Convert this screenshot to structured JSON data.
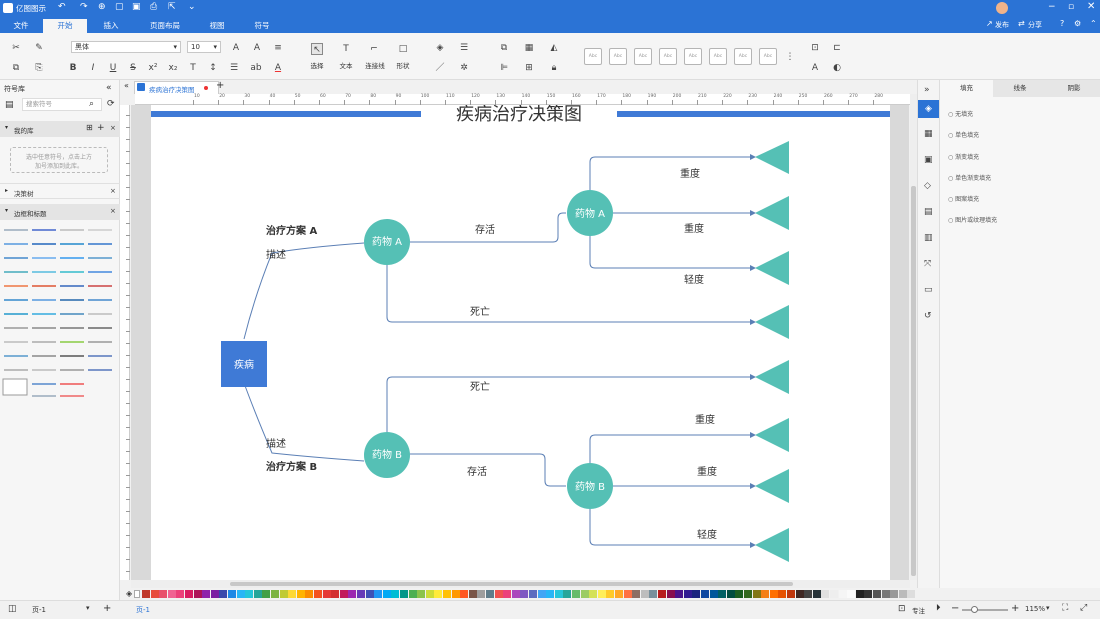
{
  "app": {
    "title": "亿图图示",
    "publish": "发布",
    "share": "分享"
  },
  "menu": [
    "文件",
    "开始",
    "插入",
    "页面布局",
    "视图",
    "符号"
  ],
  "ribbon": {
    "font": "黑体",
    "size": "10",
    "select": "选择",
    "text": "文本",
    "connector": "连接线",
    "shape": "形状",
    "style_label": "Abc"
  },
  "left": {
    "title": "符号库",
    "search_placeholder": "搜索符号",
    "my_lib": "我的库",
    "hint1": "选中任意符号，点击上方",
    "hint2": "加号添加到此库。",
    "decision": "决策树",
    "borders": "边框和标题"
  },
  "doc": {
    "tab": "疾病治疗决策图"
  },
  "diagram": {
    "title": "疾病治疗决策图",
    "root": "疾病",
    "planA": "治疗方案 A",
    "planB": "治疗方案 B",
    "desc": "描述",
    "drugA": "药物  A",
    "drugB": "药物  B",
    "survive": "存活",
    "death": "死亡",
    "severe": "重度",
    "mild": "轻度"
  },
  "right": {
    "tabs": [
      "填充",
      "线条",
      "阴影"
    ],
    "fills": [
      "无填充",
      "单色填充",
      "渐变填充",
      "单色渐变填充",
      "图案填充",
      "图片或纹理填充"
    ]
  },
  "status": {
    "page": "页-1",
    "page_tab": "页-1",
    "focus": "专注",
    "zoom": "115%"
  },
  "colors": {
    "accent": "#2b73d5",
    "teal": "#55c0b5",
    "root": "#3f7ad6",
    "line": "#5b7fb5"
  },
  "ruler": [
    "10",
    "20",
    "30",
    "40",
    "50",
    "60",
    "70",
    "80",
    "90",
    "100",
    "110",
    "120",
    "130",
    "140",
    "150",
    "160",
    "170",
    "180",
    "190",
    "200",
    "210",
    "220",
    "230",
    "240",
    "250",
    "260",
    "270",
    "280"
  ]
}
